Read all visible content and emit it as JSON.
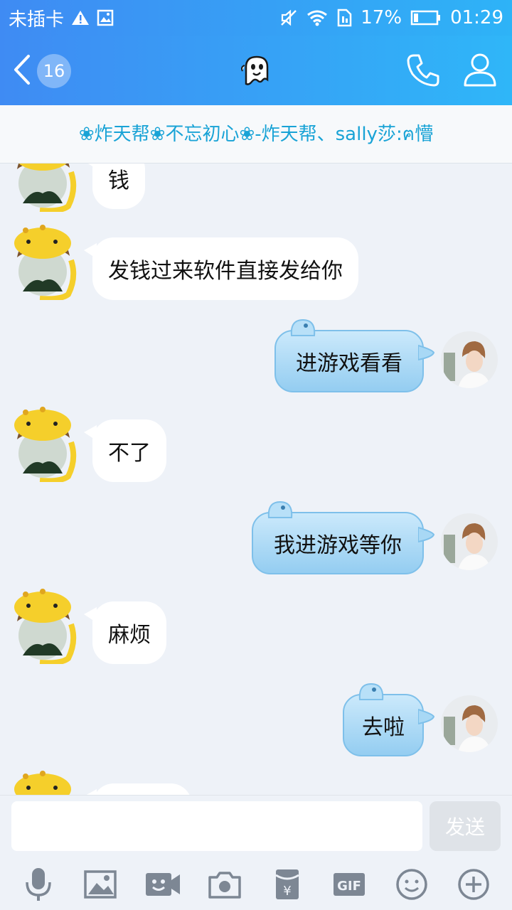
{
  "status_bar": {
    "carrier": "未插卡",
    "battery": "17%",
    "time": "01:29"
  },
  "header": {
    "unread_count": "16",
    "icons": [
      "back-arrow-icon",
      "ghost-icon",
      "phone-icon",
      "profile-icon"
    ]
  },
  "group": {
    "members_text": "❀炸天帮❀不忘初心❀-炸天帮、sally莎:ฅ懵"
  },
  "messages": [
    {
      "side": "left",
      "text": "钱"
    },
    {
      "side": "left",
      "text": "发钱过来软件直接发给你"
    },
    {
      "side": "right",
      "text": "进游戏看看"
    },
    {
      "side": "left",
      "text": "不了"
    },
    {
      "side": "right",
      "text": "我进游戏等你"
    },
    {
      "side": "left",
      "text": "麻烦"
    },
    {
      "side": "right",
      "text": "去啦"
    },
    {
      "side": "left",
      "text": ""
    }
  ],
  "input": {
    "value": "",
    "send_label": "发送"
  },
  "toolbar": {
    "gif_label": "GIF",
    "icons": [
      "mic-icon",
      "image-icon",
      "video-icon",
      "camera-icon",
      "red-packet-icon",
      "gif-icon",
      "emoji-icon",
      "plus-icon"
    ]
  },
  "colors": {
    "header_start": "#3f8bf3",
    "header_end": "#2fb6f8",
    "member_text": "#19a3d6",
    "bubble_right": "#a8d8f5"
  }
}
